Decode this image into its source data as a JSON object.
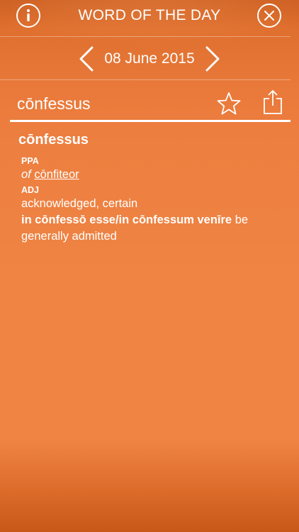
{
  "header": {
    "title": "WORD OF THE DAY",
    "info_icon": "info-icon",
    "close_icon": "close-icon"
  },
  "date_nav": {
    "date": "08 June 2015",
    "prev_icon": "chevron-left-icon",
    "next_icon": "chevron-right-icon"
  },
  "word_bar": {
    "word": "cōnfessus",
    "favorite_icon": "star-icon",
    "share_icon": "share-icon"
  },
  "entry": {
    "headword": "cōnfessus",
    "sense1": {
      "pos": "PPA",
      "of_label": "of",
      "ref_word": "cōnfiteor"
    },
    "sense2": {
      "pos": "ADJ",
      "definition": "acknowledged, certain",
      "phrase": "in cōnfessō esse/in cōnfessum venīre",
      "phrase_meaning": "be generally admitted"
    }
  },
  "colors": {
    "background": "#ef8443",
    "text": "#ffffff"
  }
}
